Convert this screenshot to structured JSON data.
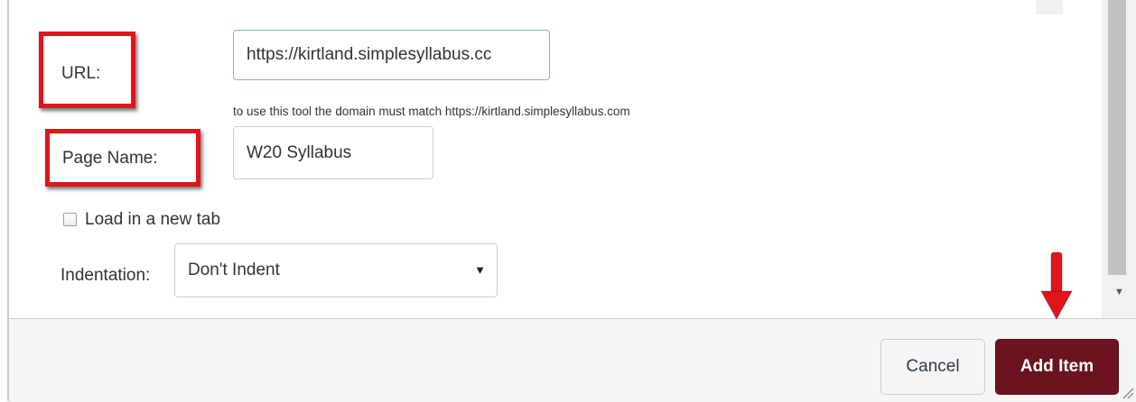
{
  "form": {
    "url_label": "URL:",
    "url_value": "https://kirtland.simplesyllabus.cc",
    "hint": "to use this tool the domain must match https://kirtland.simplesyllabus.com",
    "page_name_label": "Page Name:",
    "page_name_value": "W20 Syllabus",
    "new_tab_label": "Load in a new tab",
    "new_tab_checked": false,
    "indentation_label": "Indentation:",
    "indentation_value": "Don't Indent"
  },
  "footer": {
    "cancel_label": "Cancel",
    "add_item_label": "Add Item"
  },
  "colors": {
    "annotation_red": "#e2141b",
    "add_button": "#6b1420"
  },
  "icons": {
    "select_caret": "▼",
    "scroll_down": "▼"
  }
}
